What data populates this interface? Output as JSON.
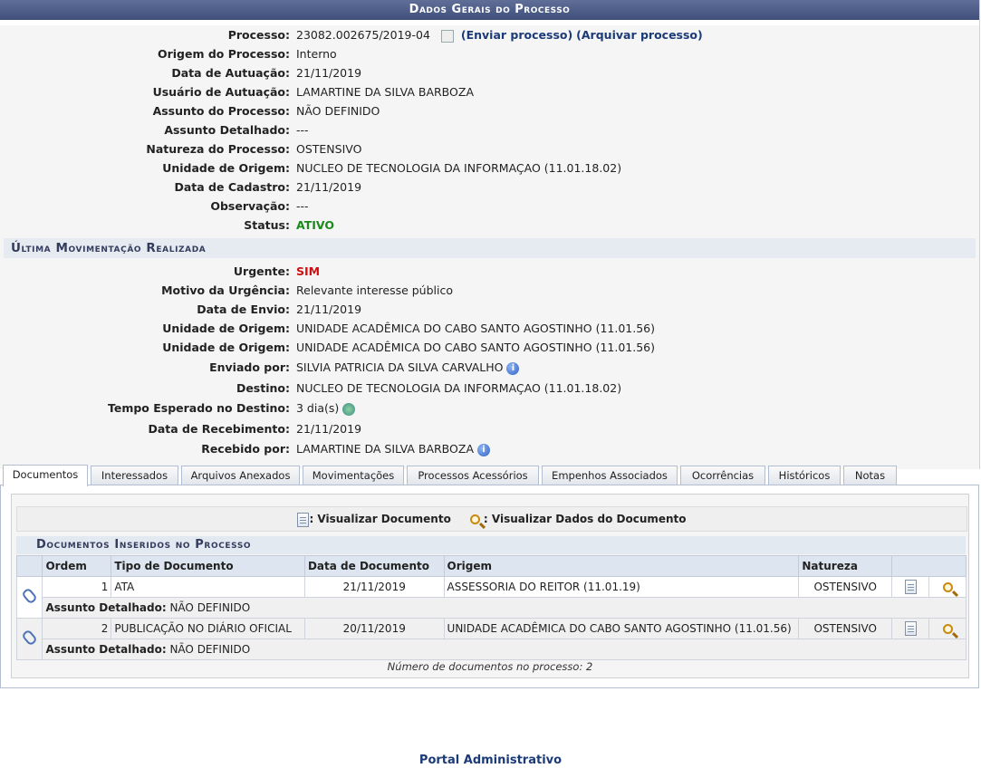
{
  "header": {
    "title": "Dados Gerais do Processo"
  },
  "processo": {
    "fields": [
      {
        "label": "Processo:",
        "value": "23082.002675/2019-04"
      },
      {
        "label": "Origem do Processo:",
        "value": "Interno"
      },
      {
        "label": "Data de Autuação:",
        "value": "21/11/2019"
      },
      {
        "label": "Usuário de Autuação:",
        "value": "LAMARTINE DA SILVA BARBOZA"
      },
      {
        "label": "Assunto do Processo:",
        "value": "NÃO DEFINIDO"
      },
      {
        "label": "Assunto Detalhado:",
        "value": "---"
      },
      {
        "label": "Natureza do Processo:",
        "value": "OSTENSIVO"
      },
      {
        "label": "Unidade de Origem:",
        "value": "NUCLEO DE TECNOLOGIA DA INFORMAÇAO (11.01.18.02)"
      },
      {
        "label": "Data de Cadastro:",
        "value": "21/11/2019"
      },
      {
        "label": "Observação:",
        "value": "---"
      },
      {
        "label": "Status:",
        "value": "ATIVO"
      }
    ],
    "enviar_link": "(Enviar processo)",
    "arquivar_link": "(Arquivar processo)"
  },
  "movimentacao": {
    "title": "Última Movimentação Realizada",
    "fields": [
      {
        "label": "Urgente:",
        "value": "SIM"
      },
      {
        "label": "Motivo da Urgência:",
        "value": "Relevante interesse público"
      },
      {
        "label": "Data de Envio:",
        "value": "21/11/2019"
      },
      {
        "label": "Unidade de Origem:",
        "value": "UNIDADE ACADÊMICA DO CABO SANTO AGOSTINHO (11.01.56)"
      },
      {
        "label": "Unidade de Origem:",
        "value": "UNIDADE ACADÊMICA DO CABO SANTO AGOSTINHO (11.01.56)"
      },
      {
        "label": "Enviado por:",
        "value": "SILVIA PATRICIA DA SILVA CARVALHO"
      },
      {
        "label": "Destino:",
        "value": "NUCLEO DE TECNOLOGIA DA INFORMAÇAO (11.01.18.02)"
      },
      {
        "label": "Tempo Esperado no Destino:",
        "value": "3 dia(s)"
      },
      {
        "label": "Data de Recebimento:",
        "value": "21/11/2019"
      },
      {
        "label": "Recebido por:",
        "value": "LAMARTINE DA SILVA BARBOZA"
      }
    ]
  },
  "tabs": [
    "Documentos",
    "Interessados",
    "Arquivos Anexados",
    "Movimentações",
    "Processos Acessórios",
    "Empenhos Associados",
    "Ocorrências",
    "Históricos",
    "Notas"
  ],
  "legend": {
    "visualizar_documento": ": Visualizar Documento",
    "visualizar_dados": ": Visualizar Dados do Documento"
  },
  "documentos": {
    "title": "Documentos Inseridos no Processo",
    "columns": [
      "Ordem",
      "Tipo de Documento",
      "Data de Documento",
      "Origem",
      "Natureza"
    ],
    "rows": [
      {
        "ordem": "1",
        "tipo": "ATA",
        "data": "21/11/2019",
        "origem": "ASSESSORIA DO REITOR (11.01.19)",
        "natureza": "OSTENSIVO",
        "assunto_label": "Assunto Detalhado:",
        "assunto": "NÃO DEFINIDO"
      },
      {
        "ordem": "2",
        "tipo": "PUBLICAÇÃO NO DIÁRIO OFICIAL",
        "data": "20/11/2019",
        "origem": "UNIDADE ACADÊMICA DO CABO SANTO AGOSTINHO (11.01.56)",
        "natureza": "OSTENSIVO",
        "assunto_label": "Assunto Detalhado:",
        "assunto": "NÃO DEFINIDO"
      }
    ],
    "footer": "Número de documentos no processo: 2"
  },
  "footer": {
    "portal": "Portal Administrativo"
  }
}
